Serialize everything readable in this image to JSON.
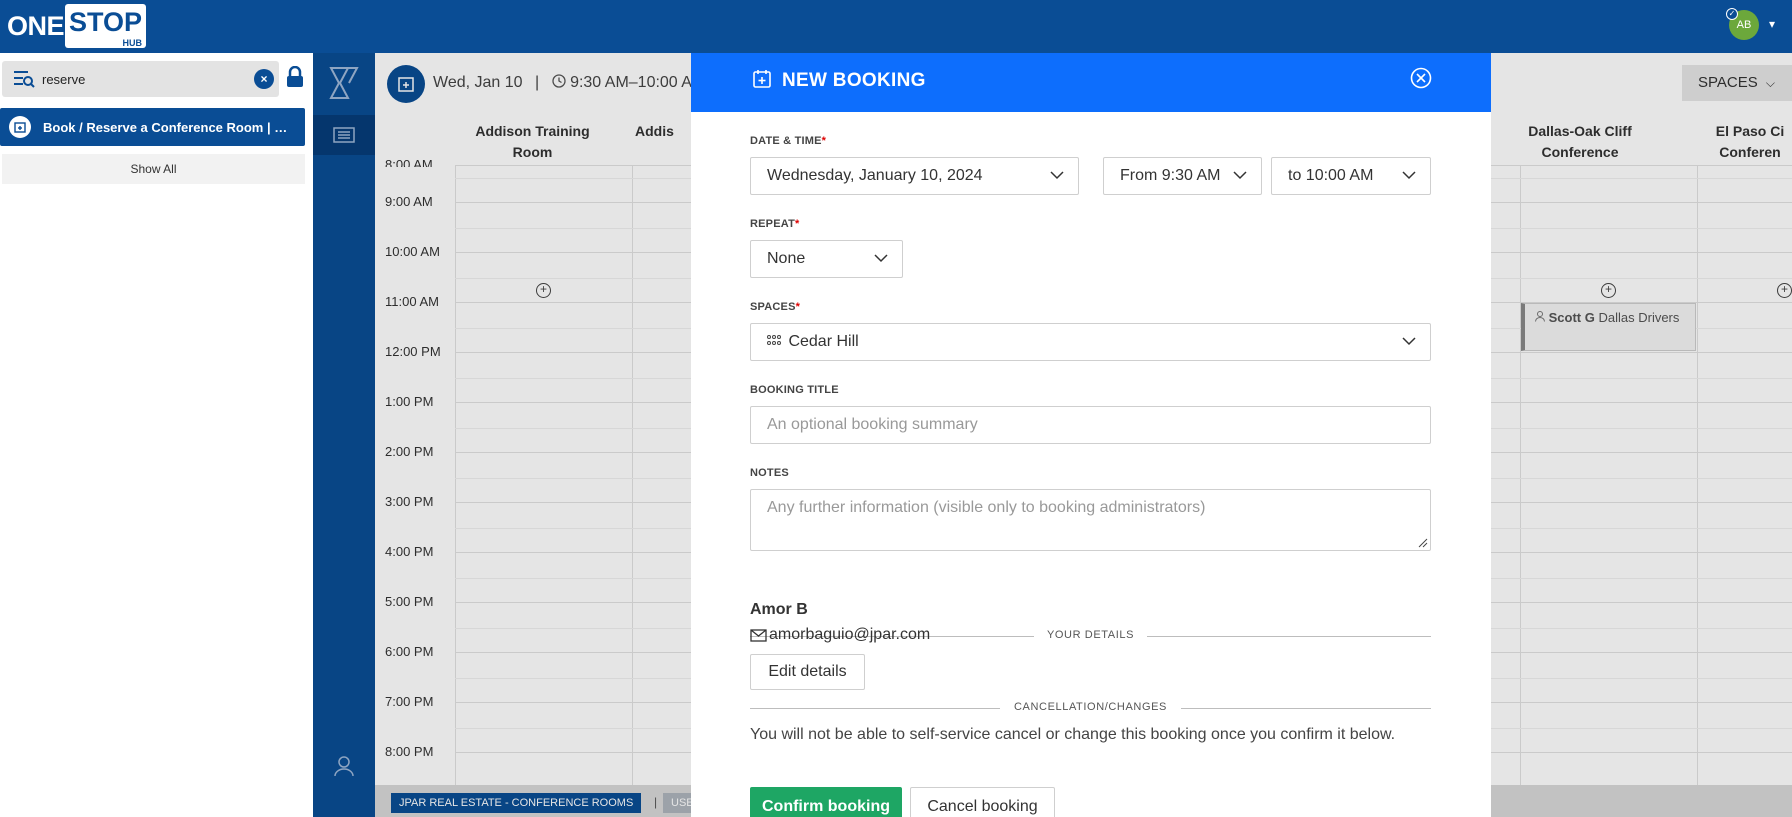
{
  "app": {
    "logo_one": "ONE",
    "logo_stop": "STOP",
    "logo_hub": "HUB",
    "user_initials": "AB"
  },
  "search": {
    "value": "reserve",
    "clear_symbol": "×",
    "result_label": "Book / Reserve a Conference Room | Br...",
    "show_all": "Show All"
  },
  "calendar": {
    "date": "Wed, Jan 10",
    "separator": "|",
    "time_range": "9:30 AM–10:00 A",
    "spaces_label": "SPACES",
    "columns": [
      {
        "name": "Addison Training Room"
      },
      {
        "name": "Addis"
      },
      {
        "name": "Dallas-Oak Cliff Conference"
      },
      {
        "name": "El Paso Ci Conferen"
      }
    ],
    "times": [
      "8:00 AM",
      "9:00 AM",
      "10:00 AM",
      "11:00 AM",
      "12:00 PM",
      "1:00 PM",
      "2:00 PM",
      "3:00 PM",
      "4:00 PM",
      "5:00 PM",
      "6:00 PM",
      "7:00 PM",
      "8:00 PM"
    ],
    "booking": {
      "name": "Scott G",
      "title_rest": "Dallas Drivers"
    },
    "footer_tag": "JPAR REAL ESTATE - CONFERENCE ROOMS",
    "footer_sep": "|",
    "footer_tag2": "USE"
  },
  "modal": {
    "title": "NEW BOOKING",
    "date_time_label": "DATE & TIME",
    "required_mark": "*",
    "date_value": "Wednesday, January 10, 2024",
    "from_value": "From 9:30 AM",
    "to_value": "to 10:00 AM",
    "repeat_label": "REPEAT",
    "repeat_value": "None",
    "spaces_label": "SPACES",
    "spaces_value": "Cedar Hill",
    "booking_title_label": "BOOKING TITLE",
    "booking_title_placeholder": "An optional booking summary",
    "notes_label": "NOTES",
    "notes_placeholder": "Any further information (visible only to booking administrators)",
    "your_details_label": "YOUR DETAILS",
    "user_name": "Amor B",
    "user_email": "amorbaguio@jpar.com",
    "edit_details": "Edit details",
    "cancellation_label": "CANCELLATION/CHANGES",
    "notice": "You will not be able to self-service cancel or change this booking once you confirm it below.",
    "confirm": "Confirm booking",
    "cancel": "Cancel booking"
  },
  "colors": {
    "brand_blue": "#0a4d95",
    "modal_header": "#0d6efd",
    "confirm_green": "#1ea664",
    "avatar_green": "#6ca83b"
  }
}
